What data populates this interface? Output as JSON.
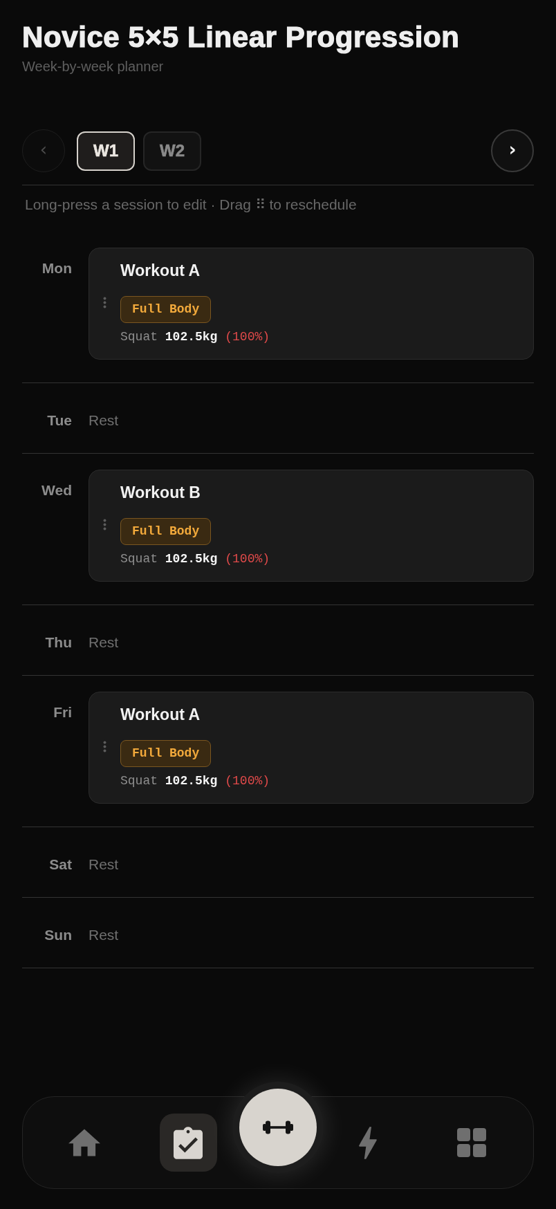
{
  "header": {
    "title": "Novice 5×5 Linear Progression",
    "subtitle": "Week-by-week planner"
  },
  "week_nav": {
    "prev": {
      "label": "‹",
      "disabled": true
    },
    "weeks": [
      {
        "label": "W1",
        "selected": true
      },
      {
        "label": "W2",
        "selected": false
      }
    ],
    "next": {
      "label": "›",
      "disabled": false
    }
  },
  "hint": "Long-press a session to edit · Drag ⠿ to reschedule",
  "days": [
    {
      "day": "Mon",
      "kind": "workout",
      "session": {
        "title": "Workout A",
        "tag": "Full Body",
        "lift": "Squat",
        "weight": "102.5kg",
        "percent": "(100%)"
      }
    },
    {
      "day": "Tue",
      "kind": "rest",
      "note": "Rest"
    },
    {
      "day": "Wed",
      "kind": "workout",
      "session": {
        "title": "Workout B",
        "tag": "Full Body",
        "lift": "Squat",
        "weight": "102.5kg",
        "percent": "(100%)"
      }
    },
    {
      "day": "Thu",
      "kind": "rest",
      "note": "Rest"
    },
    {
      "day": "Fri",
      "kind": "workout",
      "session": {
        "title": "Workout A",
        "tag": "Full Body",
        "lift": "Squat",
        "weight": "102.5kg",
        "percent": "(100%)"
      }
    },
    {
      "day": "Sat",
      "kind": "rest",
      "note": "Rest"
    },
    {
      "day": "Sun",
      "kind": "rest",
      "note": "Rest"
    }
  ],
  "bottom_nav": [
    {
      "kind": "tab",
      "selected": false
    },
    {
      "kind": "tab",
      "selected": true
    },
    {
      "kind": "action"
    },
    {
      "kind": "tab",
      "selected": false
    },
    {
      "kind": "tab",
      "selected": false
    }
  ]
}
